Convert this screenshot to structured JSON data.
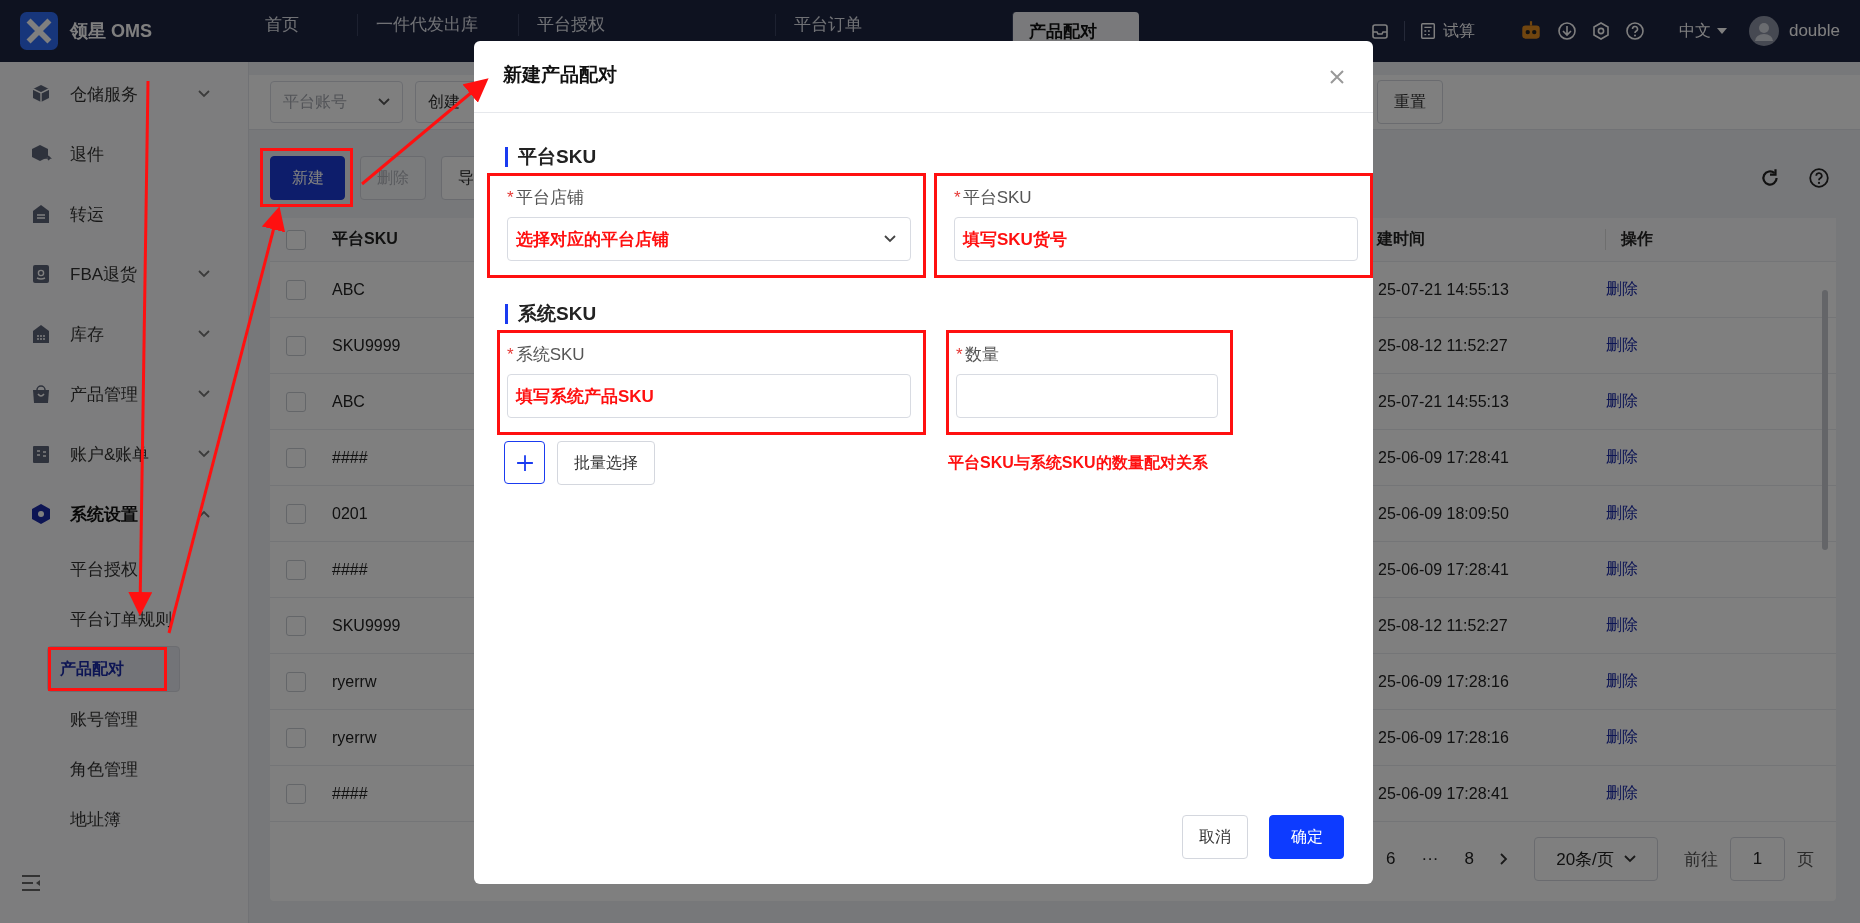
{
  "app": {
    "logo_text": "领星 OMS"
  },
  "top_tabs": [
    {
      "label": "首页",
      "selected": false
    },
    {
      "label": "一件代发出库",
      "selected": false
    },
    {
      "label": "平台授权",
      "selected": false
    },
    {
      "label": "平台订单",
      "selected": false
    },
    {
      "label": "产品配对",
      "selected": true
    }
  ],
  "top_actions": {
    "trial_label": "试算",
    "language": "中文",
    "user": "double"
  },
  "sidebar": {
    "items": [
      {
        "label": "仓储服务",
        "expandable": true,
        "expanded": false
      },
      {
        "label": "退件",
        "expandable": false,
        "expanded": false
      },
      {
        "label": "转运",
        "expandable": false,
        "expanded": false
      },
      {
        "label": "FBA退货",
        "expandable": true,
        "expanded": false
      },
      {
        "label": "库存",
        "expandable": true,
        "expanded": false
      },
      {
        "label": "产品管理",
        "expandable": true,
        "expanded": false
      },
      {
        "label": "账户&账单",
        "expandable": true,
        "expanded": false
      },
      {
        "label": "系统设置",
        "expandable": true,
        "expanded": true,
        "children": [
          {
            "label": "平台授权",
            "selected": false,
            "annotated": false
          },
          {
            "label": "平台订单规则",
            "selected": false,
            "annotated": false
          },
          {
            "label": "产品配对",
            "selected": true,
            "annotated": true
          },
          {
            "label": "账号管理",
            "selected": false,
            "annotated": false
          },
          {
            "label": "角色管理",
            "selected": false,
            "annotated": false
          },
          {
            "label": "地址簿",
            "selected": false,
            "annotated": false
          }
        ]
      }
    ]
  },
  "filters": {
    "account_placeholder": "平台账号",
    "date_placeholder": "创建",
    "reset_button": "重置"
  },
  "toolbar": {
    "buttons": [
      {
        "label": "新建",
        "kind": "primary",
        "disabled": false,
        "annotated": true
      },
      {
        "label": "删除",
        "kind": "default",
        "disabled": true,
        "annotated": false
      },
      {
        "label": "导",
        "kind": "default",
        "disabled": false,
        "annotated": false
      }
    ]
  },
  "table": {
    "all_checked": false,
    "columns": [
      "平台SKU",
      "建时间",
      "操作"
    ],
    "rows": [
      {
        "checked": false,
        "sku": "ABC",
        "created": "25-07-21 14:55:13",
        "action": "删除"
      },
      {
        "checked": false,
        "sku": "SKU9999",
        "created": "25-08-12 11:52:27",
        "action": "删除"
      },
      {
        "checked": false,
        "sku": "ABC",
        "created": "25-07-21 14:55:13",
        "action": "删除"
      },
      {
        "checked": false,
        "sku": "####",
        "created": "25-06-09 17:28:41",
        "action": "删除"
      },
      {
        "checked": false,
        "sku": "0201",
        "created": "25-06-09 18:09:50",
        "action": "删除"
      },
      {
        "checked": false,
        "sku": "####",
        "created": "25-06-09 17:28:41",
        "action": "删除"
      },
      {
        "checked": false,
        "sku": "SKU9999",
        "created": "25-08-12 11:52:27",
        "action": "删除"
      },
      {
        "checked": false,
        "sku": "ryerrw",
        "created": "25-06-09 17:28:16",
        "action": "删除"
      },
      {
        "checked": false,
        "sku": "ryerrw",
        "created": "25-06-09 17:28:16",
        "action": "删除"
      },
      {
        "checked": false,
        "sku": "####",
        "created": "25-06-09 17:28:41",
        "action": "删除"
      }
    ]
  },
  "pagination": {
    "pages": [
      "6",
      "···",
      "8"
    ],
    "page_size": "20条/页",
    "goto_label": "前往",
    "goto_value": "1",
    "page_unit": "页"
  },
  "dialog": {
    "title": "新建产品配对",
    "sections": [
      {
        "title": "平台SKU",
        "fields": [
          {
            "required_mark": "*",
            "label": "平台店铺",
            "kind": "select",
            "annotation": "选择对应的平台店铺",
            "annotated": true
          },
          {
            "required_mark": "*",
            "label": "平台SKU",
            "kind": "input",
            "annotation": "填写SKU货号",
            "annotated": true
          }
        ]
      },
      {
        "title": "系统SKU",
        "fields": [
          {
            "required_mark": "*",
            "label": "系统SKU",
            "kind": "input",
            "annotation": "填写系统产品SKU",
            "annotated": true
          },
          {
            "required_mark": "*",
            "label": "数量",
            "kind": "input",
            "annotated": true
          }
        ]
      }
    ],
    "batch_button": "批量选择",
    "note": "平台SKU与系统SKU的数量配对关系",
    "cancel": "取消",
    "confirm": "确定"
  }
}
